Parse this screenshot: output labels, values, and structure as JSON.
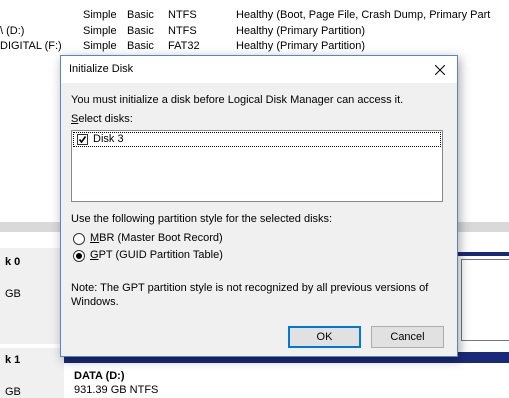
{
  "volumes": [
    {
      "name": "",
      "layout": "Simple",
      "type": "Basic",
      "fs": "NTFS",
      "status": "Healthy (Boot, Page File, Crash Dump, Primary Part"
    },
    {
      "name": "\\ (D:)",
      "layout": "Simple",
      "type": "Basic",
      "fs": "NTFS",
      "status": "Healthy (Primary Partition)"
    },
    {
      "name": "DIGITAL (F:)",
      "layout": "Simple",
      "type": "Basic",
      "fs": "FAT32",
      "status": "Healthy (Primary Partition)"
    }
  ],
  "disks": [
    {
      "name_partial": "k 0",
      "size_partial": "GB"
    },
    {
      "name_partial": "k 1",
      "size_partial": "GB",
      "partition_name": "DATA  (D:)",
      "partition_detail": "931.39 GB NTFS"
    }
  ],
  "dialog": {
    "title": "Initialize Disk",
    "intro": "You must initialize a disk before Logical Disk Manager can access it.",
    "select_label_u": "S",
    "select_label_rest": "elect disks:",
    "disk_item": "Disk 3",
    "disk_checked": true,
    "style_label": "Use the following partition style for the selected disks:",
    "options": [
      {
        "u": "M",
        "rest": "BR (Master Boot Record)",
        "selected": false
      },
      {
        "u": "G",
        "rest": "PT (GUID Partition Table)",
        "selected": true
      }
    ],
    "note_line1": "Note: The GPT partition style is not recognized by all previous versions of",
    "note_line2": "Windows.",
    "ok_label": "OK",
    "cancel_label": "Cancel"
  },
  "colors": {
    "disk_bar": "#1a2a7a",
    "dialog_border": "#5a86c5",
    "button_focus": "#0078d7"
  }
}
